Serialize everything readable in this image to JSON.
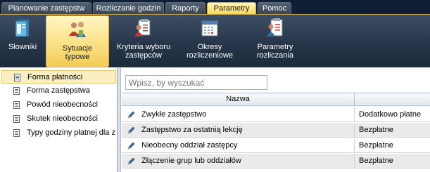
{
  "tabs": [
    {
      "label": "Planowanie zastępstw",
      "active": false
    },
    {
      "label": "Rozliczanie godzin",
      "active": false
    },
    {
      "label": "Raporty",
      "active": false
    },
    {
      "label": "Parametry",
      "active": true
    },
    {
      "label": "Pomoc",
      "active": false
    }
  ],
  "ribbon": [
    {
      "label": "Słowniki",
      "icon": "dictionary-icon",
      "active": false
    },
    {
      "label": "Sytuacje typowe",
      "icon": "people-icon",
      "active": true
    },
    {
      "label": "Kryteria wyboru zastępców",
      "icon": "criteria-icon",
      "active": false
    },
    {
      "label": "Okresy rozliczeniowe",
      "icon": "calendar-icon",
      "active": false
    },
    {
      "label": "Parametry rozliczania",
      "icon": "settings-doc-icon",
      "active": false
    }
  ],
  "tree": {
    "items": [
      {
        "label": "Forma płatności",
        "selected": true
      },
      {
        "label": "Forma zastępstwa",
        "selected": false
      },
      {
        "label": "Powód nieobecności",
        "selected": false
      },
      {
        "label": "Skutek nieobecności",
        "selected": false
      },
      {
        "label": "Typy godziny płatnej dla z",
        "selected": false
      }
    ]
  },
  "search": {
    "placeholder": "Wpisz, by wyszukać"
  },
  "grid": {
    "columns": [
      "Nazwa",
      ""
    ],
    "rows": [
      {
        "name": "Zwykłe zastępstwo",
        "value": "Dodatkowo płatne"
      },
      {
        "name": "Zastępstwo za ostatnią lekcję",
        "value": "Bezpłatne"
      },
      {
        "name": "Nieobecny oddział zastępcy",
        "value": "Bezpłatne"
      },
      {
        "name": "Złączenie grup lub oddziałów",
        "value": "Bezpłatne"
      }
    ]
  },
  "colors": {
    "tab_active": "#f7d85c",
    "ribbon_bg": "#27364a",
    "selection": "#fbeec1",
    "row_alt": "#eaeaea"
  }
}
